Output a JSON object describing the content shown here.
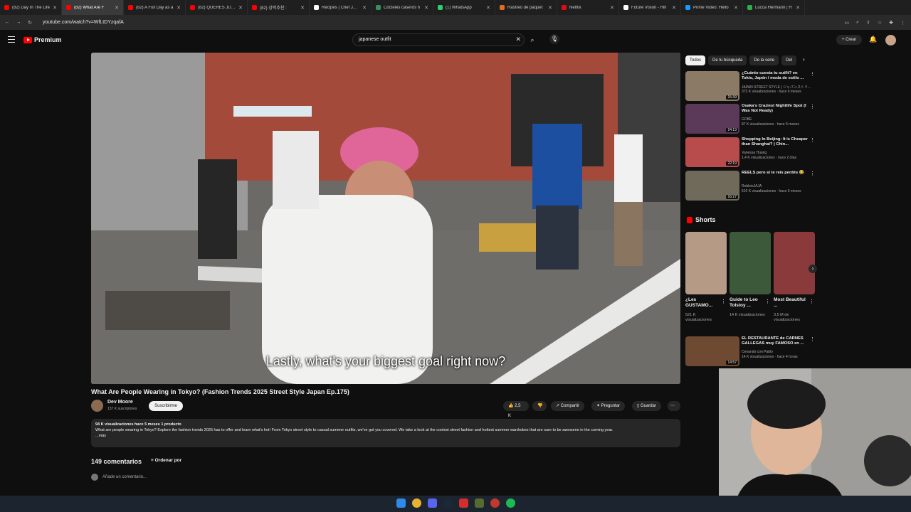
{
  "browser": {
    "tabs": [
      {
        "label": "(82) Day In The Life",
        "color": "#ff0000"
      },
      {
        "label": "(82) What Are F",
        "color": "#ff0000",
        "active": true
      },
      {
        "label": "(82) A Full Day as a",
        "color": "#ff0000"
      },
      {
        "label": "(82) QUERÉS JUGA",
        "color": "#ff0000"
      },
      {
        "label": "(82) 강력추천 :",
        "color": "#ff0000"
      },
      {
        "label": "Recipes | Chef Josh",
        "color": "#ffffff"
      },
      {
        "label": "Cócteles caseros h",
        "color": "#3a8f5c"
      },
      {
        "label": "(1) WhatsApp",
        "color": "#25d366"
      },
      {
        "label": "Rastreo de paquet",
        "color": "#e46b1d"
      },
      {
        "label": "Netflix",
        "color": "#e50914"
      },
      {
        "label": "Future Vision - Hill",
        "color": "#ffffff"
      },
      {
        "label": "Prime Video: Hello",
        "color": "#1a98ff"
      },
      {
        "label": "Lucca Hermann | H",
        "color": "#2fae4c"
      }
    ],
    "url": "youtube.com/watch?v=WfLtDYzqafA"
  },
  "header": {
    "brand": "Premium",
    "search_value": "japanese outfit",
    "create_label": "+ Crear",
    "notif_count": "9+"
  },
  "video": {
    "subtitle": "Lastly, what's your biggest goal right now?",
    "title": "What Are People Wearing in Tokyo? (Fashion Trends 2025 Street Style Japan Ep.175)",
    "channel": "Dev Moore",
    "subscribers": "137 K suscriptores",
    "subscribe_label": "Suscribirme",
    "likes": "2,5 K",
    "share_label": "Compartir",
    "ask_label": "Preguntar",
    "save_label": "Guardar",
    "description_meta": "94 K visualizaciones  hace 5 meses  1 producto",
    "description": "What are people wearing in Tokyo? Explore the fashion trends 2025 has to offer and learn what's hot! From Tokyo street style to casual summer outfits, we've got you covered. We take a look at the coolest street fashion and hottest summer wardrobes that are sure to be awesome in the coming year.",
    "more_label": "...más",
    "comments_count": "149 comentarios",
    "sort_label": "Ordenar por",
    "add_comment": "Añade un comentario..."
  },
  "sidebar": {
    "chips": [
      "Todos",
      "De tu búsqueda",
      "De la serie",
      "Del"
    ],
    "recs": [
      {
        "title": "¿Cuánto cuesta tu outfit? en Tokio, Japón / moda de estilo ...",
        "channel": "JAPAN STREET STYLE | ジャパンストリ...",
        "meta": "373 K visualizaciones · hace 6 meses",
        "duration": "15:39",
        "color": "#8a7a66"
      },
      {
        "title": "Osaka's Craziest Nightlife Spot (I Was Not Ready)",
        "channel": "GOBE",
        "meta": "87 K visualizaciones · hace 6 meses",
        "duration": "24:13",
        "color": "#5a3a58"
      },
      {
        "title": "Shopping In Beijing: It is Cheaper than Shanghai? | Chin...",
        "channel": "Vanessa Huang",
        "meta": "1,4 K visualizaciones · hace 2 días",
        "duration": "22:19",
        "color": "#b84b4b"
      },
      {
        "title": "REELS pero si te reís perdés 😂",
        "channel": "RobleisJAJA",
        "meta": "510 K visualizaciones · hace 6 meses",
        "duration": "16:27",
        "color": "#6f6a5a"
      }
    ],
    "shorts_label": "Shorts",
    "shorts": [
      {
        "title": "¿Les GUSTAMO...",
        "views": "521 K visualizaciones",
        "color": "#b59a86"
      },
      {
        "title": "Guide to Leo Tolstoy ...",
        "views": "14 K visualizaciones",
        "color": "#3c5a3a"
      },
      {
        "title": "Most Beautiful ...",
        "views": "3,5 M de visualizaciones",
        "color": "#8a3a3a"
      }
    ],
    "bottom_rec": {
      "title": "EL RESTAURANTE de CARNES GALLEGAS muy FAMOSO en ...",
      "channel": "Cenando con Pablo",
      "meta": "14 K visualizaciones · hace 4 horas",
      "duration": "14:57",
      "color": "#6e4a32"
    }
  }
}
